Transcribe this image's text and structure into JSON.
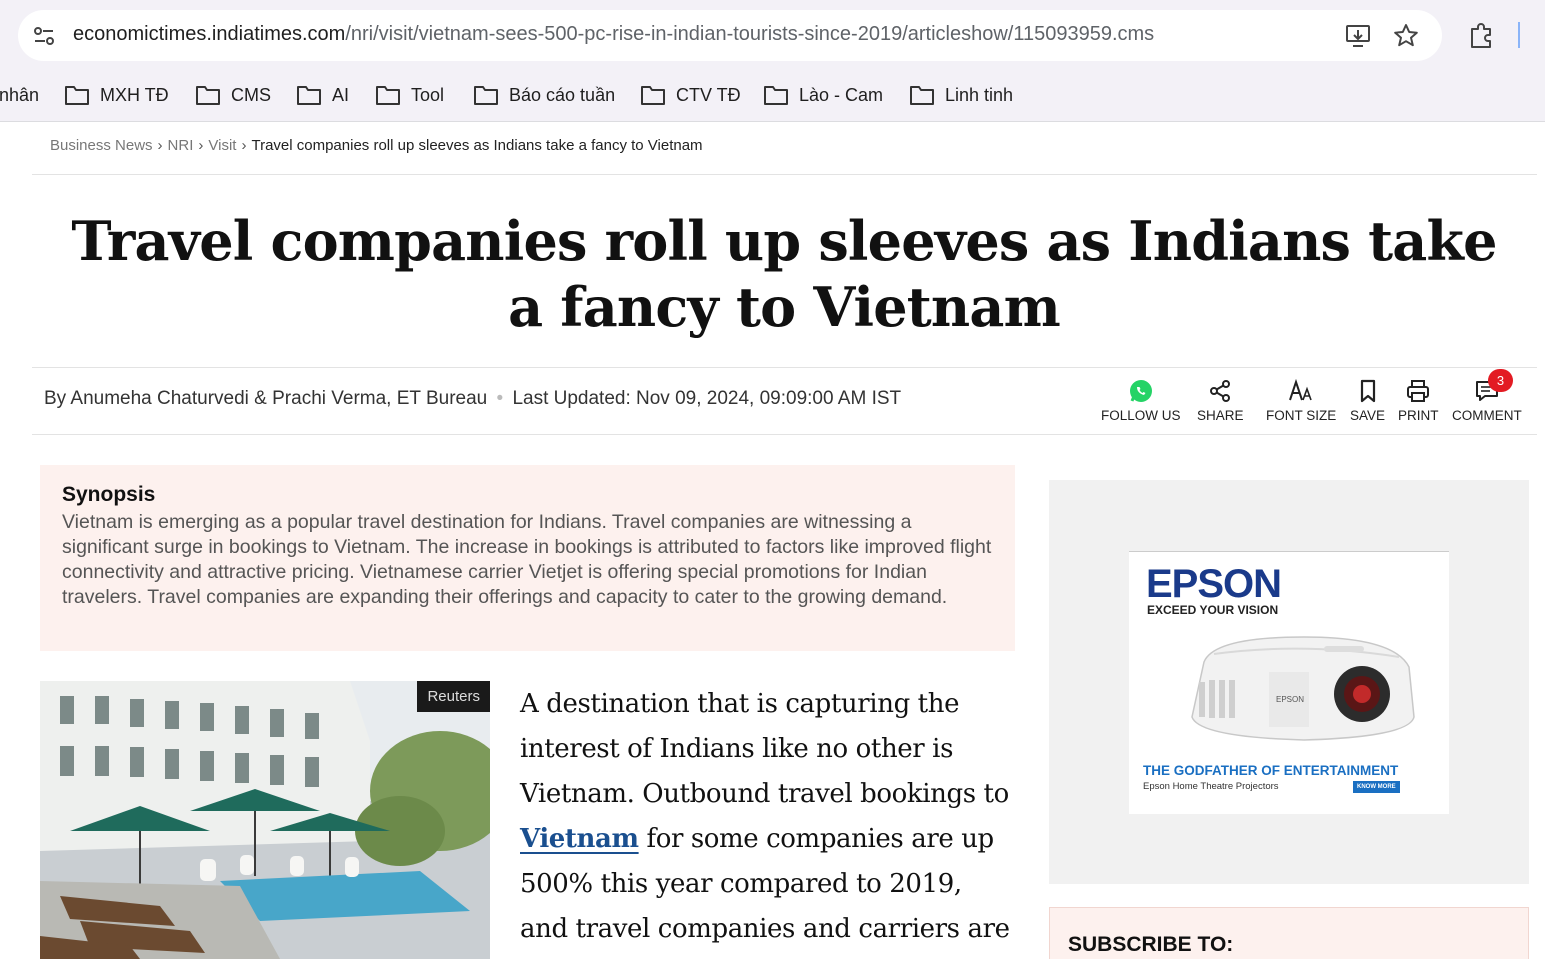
{
  "browser": {
    "url_domain": "economictimes.indiatimes.com",
    "url_path": "/nri/visit/vietnam-sees-500-pc-rise-in-indian-tourists-since-2019/articleshow/115093959.cms",
    "bookmarks": [
      "nhân",
      "MXH TĐ",
      "CMS",
      "AI",
      "Tool",
      "Báo cáo tuần",
      "CTV TĐ",
      "Lào - Cam",
      "Linh tinh"
    ]
  },
  "breadcrumb": {
    "items": [
      "Business News",
      "NRI",
      "Visit"
    ],
    "separator": "›",
    "current": "Travel companies roll up sleeves as Indians take a fancy to Vietnam"
  },
  "article": {
    "headline": "Travel companies roll up sleeves as Indians take a fancy to Vietnam",
    "byline": "By Anumeha Chaturvedi & Prachi Verma, ET Bureau",
    "byline_dot": "•",
    "updated": "Last Updated: Nov 09, 2024, 09:09:00 AM IST",
    "tools": {
      "follow": "FOLLOW US",
      "share": "SHARE",
      "font_size": "FONT SIZE",
      "save": "SAVE",
      "print": "PRINT",
      "comment": "COMMENT",
      "comment_count": "3"
    },
    "synopsis_title": "Synopsis",
    "synopsis_text": "Vietnam is emerging as a popular travel destination for Indians. Travel companies are witnessing a significant surge in bookings to Vietnam. The increase in bookings is attributed to factors like improved flight connectivity and attractive pricing. Vietnamese carrier Vietjet is offering special promotions for Indian travelers. Travel companies are expanding their offerings and capacity to cater to the growing demand.",
    "photo_credit": "Reuters",
    "body_before_link": "A destination that is capturing the interest of Indians like no other is Vietnam. Outbound travel bookings to ",
    "body_link": "Vietnam",
    "body_after_link": " for some companies are up 500% this year compared to 2019, and travel companies and carriers are"
  },
  "ad": {
    "brand": "EPSON",
    "tagline": "EXCEED YOUR VISION",
    "product_label": "EPSON",
    "headline": "THE GODFATHER OF ENTERTAINMENT",
    "sub": "Epson Home Theatre Projectors",
    "cta": "KNOW MORE"
  },
  "subscribe": {
    "title": "SUBSCRIBE TO:"
  },
  "colors": {
    "accent_link": "#1a4f8f",
    "whatsapp": "#25d366",
    "badge": "#e31b23",
    "synopsis_bg": "#fdf1ee"
  }
}
